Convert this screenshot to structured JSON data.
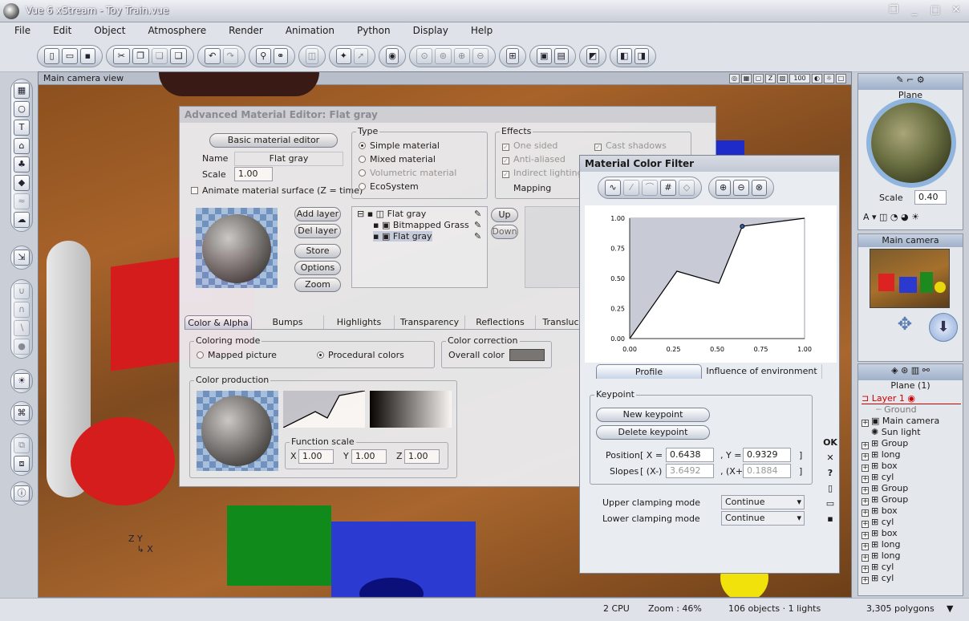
{
  "app": {
    "title": "Vue 6 xStream - Toy Train.vue",
    "window_buttons": [
      "❐",
      "_",
      "□",
      "✕"
    ]
  },
  "menu": [
    "File",
    "Edit",
    "Object",
    "Atmosphere",
    "Render",
    "Animation",
    "Python",
    "Display",
    "Help"
  ],
  "viewport": {
    "title": "Main camera view",
    "zoom_label": "100",
    "axes_label": "Z Y\n   ↳ X"
  },
  "status": {
    "cpu": "2 CPU",
    "zoom": "Zoom : 46%",
    "objects": "106 objects · 1 lights",
    "polygons": "3,305 polygons"
  },
  "ame": {
    "title": "Advanced Material Editor: Flat gray",
    "basic_button": "Basic material editor",
    "name_label": "Name",
    "name_value": "Flat gray",
    "scale_label": "Scale",
    "scale_value": "1.00",
    "animate_label": "Animate material surface (Z = time)",
    "type_label": "Type",
    "types": [
      "Simple material",
      "Mixed material",
      "Volumetric material",
      "EcoSystem"
    ],
    "effects_label": "Effects",
    "effects_left": [
      "One sided",
      "Anti-aliased",
      "Indirect lighting"
    ],
    "effects_right": [
      "Cast shadows"
    ],
    "mapping_label": "Mapping",
    "layer_buttons": [
      "Add layer",
      "Del layer",
      "Store",
      "Options",
      "Zoom"
    ],
    "layers": [
      "Flat gray",
      "Bitmapped Grass",
      "Flat gray"
    ],
    "up_label": "Up",
    "down_label": "Down",
    "tabs": [
      "Color & Alpha",
      "Bumps",
      "Highlights",
      "Transparency",
      "Reflections",
      "Transluc"
    ],
    "coloring_mode_label": "Coloring mode",
    "mapped_picture": "Mapped picture",
    "procedural_colors": "Procedural colors",
    "color_correction_label": "Color correction",
    "overall_color": "Overall color",
    "color_production_label": "Color production",
    "function_scale_label": "Function scale",
    "fs_x_label": "X",
    "fs_y_label": "Y",
    "fs_z_label": "Z",
    "fs_x": "1.00",
    "fs_y": "1.00",
    "fs_z": "1.00"
  },
  "mcf": {
    "title": "Material Color Filter",
    "tabs": [
      "Profile",
      "Influence of environment"
    ],
    "keypoint_label": "Keypoint",
    "new_keypoint": "New keypoint",
    "delete_keypoint": "Delete keypoint",
    "position_label": "Position",
    "pos_x_label": "[ X =",
    "pos_y_label": ", Y =",
    "pos_x": "0.6438",
    "pos_y": "0.9329",
    "slopes_label": "Slopes",
    "slope_l_label": "[ (X-)",
    "slope_r_label": ", (X+)",
    "slope_l": "3.6492",
    "slope_r": "0.1884",
    "close_bracket": "]",
    "upper_clamp_label": "Upper clamping mode",
    "lower_clamp_label": "Lower clamping mode",
    "upper_clamp": "Continue",
    "lower_clamp": "Continue",
    "side_ok": "OK",
    "side_x": "✕",
    "side_q": "?"
  },
  "chart_data": {
    "type": "line",
    "title": "",
    "x": [
      0.0,
      0.27,
      0.51,
      0.6438,
      1.0
    ],
    "y": [
      0.0,
      0.56,
      0.46,
      0.9329,
      1.0
    ],
    "xlim": [
      0,
      1
    ],
    "ylim": [
      0,
      1
    ],
    "x_ticks": [
      "0.00",
      "0.25",
      "0.50",
      "0.75",
      "1.00"
    ],
    "y_ticks": [
      "0.00",
      "0.25",
      "0.50",
      "0.75",
      "1.00"
    ],
    "grid": false
  },
  "right": {
    "material_name": "Plane",
    "scale_label": "Scale",
    "scale_value": "0.40",
    "camera_label": "Main camera",
    "tree_header": "Plane (1)",
    "layer_name": "Layer 1",
    "tree": [
      "Ground",
      "Main camera",
      "Sun light",
      "Group",
      "long",
      "box",
      "cyl",
      "Group",
      "Group",
      "box",
      "cyl",
      "box",
      "long",
      "long",
      "cyl",
      "cyl"
    ]
  },
  "colors": {
    "accent": "#7b8aa2",
    "layer_red": "#cc0000",
    "wood": "#a8632a"
  }
}
